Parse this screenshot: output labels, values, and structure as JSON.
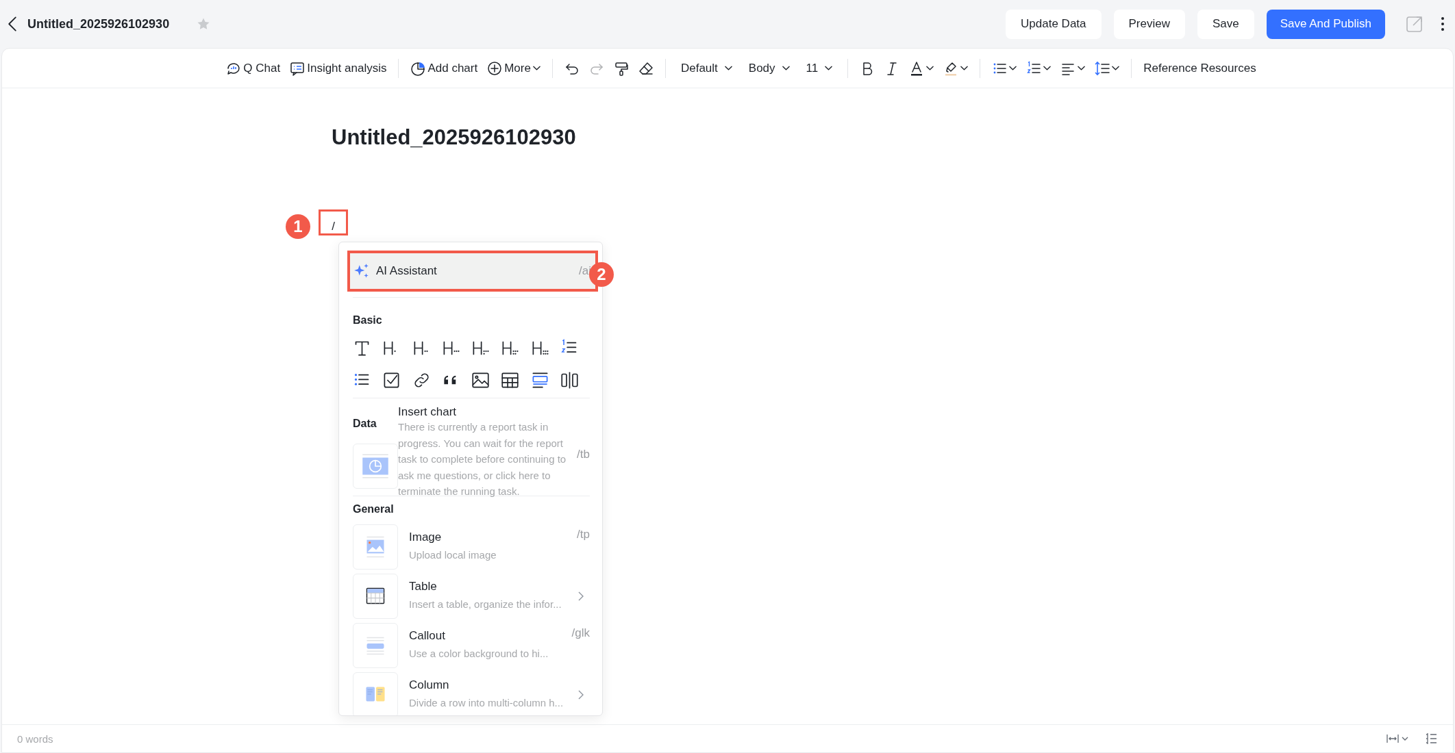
{
  "top_bar": {
    "title": "Untitled_2025926102930",
    "buttons": [
      {
        "label": "Update Data",
        "kind": "default"
      },
      {
        "label": "Preview",
        "kind": "default"
      },
      {
        "label": "Save",
        "kind": "default"
      },
      {
        "label": "Save And Publish",
        "kind": "primary"
      }
    ]
  },
  "toolbar": [
    {
      "kind": "icon_text",
      "label": "Q Chat"
    },
    {
      "kind": "icon_text",
      "label": "Insight analysis"
    },
    {
      "kind": "divider"
    },
    {
      "kind": "icon_text",
      "label": "Add chart"
    },
    {
      "kind": "icon_text_dropdown",
      "label": "More"
    },
    {
      "kind": "divider"
    },
    {
      "kind": "icon",
      "disabled": false
    },
    {
      "kind": "icon",
      "disabled": true
    },
    {
      "kind": "icon",
      "disabled": false
    },
    {
      "kind": "icon",
      "disabled": false
    },
    {
      "kind": "divider"
    },
    {
      "kind": "select",
      "label": "Default"
    },
    {
      "kind": "select",
      "label": "Body"
    },
    {
      "kind": "select",
      "label": "11"
    },
    {
      "kind": "divider"
    },
    {
      "kind": "icon",
      "disabled": false
    },
    {
      "kind": "icon",
      "disabled": false
    },
    {
      "kind": "icon_dropdown",
      "disabled": false
    },
    {
      "kind": "icon_dropdown",
      "disabled": false
    },
    {
      "kind": "divider"
    },
    {
      "kind": "icon_dropdown",
      "disabled": false
    },
    {
      "kind": "icon_dropdown",
      "disabled": false
    },
    {
      "kind": "icon_dropdown",
      "disabled": false
    },
    {
      "kind": "icon_dropdown",
      "disabled": false
    },
    {
      "kind": "divider"
    },
    {
      "kind": "text",
      "label": "Reference Resources"
    }
  ],
  "document": {
    "title": "Untitled_2025926102930",
    "line": "/"
  },
  "insert_menu": {
    "ai_item": {
      "label": "AI Assistant",
      "shortcut": "/ai",
      "selected": true
    },
    "basic": {
      "title": "Basic"
    },
    "data": {
      "title": "Data",
      "items": [
        {
          "label": "Insert chart",
          "description": "There is currently a report task in progress. You can wait for the report task to complete before continuing to ask me questions, or click here to terminate the running task.",
          "kind": "shortcut",
          "shortcut": "/tb"
        }
      ]
    },
    "general": {
      "title": "General",
      "items": [
        {
          "label": "Image",
          "description": "Upload local image",
          "kind": "shortcut",
          "shortcut": "/tp"
        },
        {
          "label": "Table",
          "description": "Insert a table, organize the infor...",
          "kind": "submenu"
        },
        {
          "label": "Callout",
          "description": "Use a color background to hi...",
          "kind": "shortcut",
          "shortcut": "/glk"
        },
        {
          "label": "Column",
          "description": "Divide a row into multi-column h...",
          "kind": "submenu"
        }
      ]
    }
  },
  "annotations": [
    {
      "label": "1"
    },
    {
      "label": "2"
    }
  ],
  "status_bar": {
    "word_count": "0 words"
  }
}
